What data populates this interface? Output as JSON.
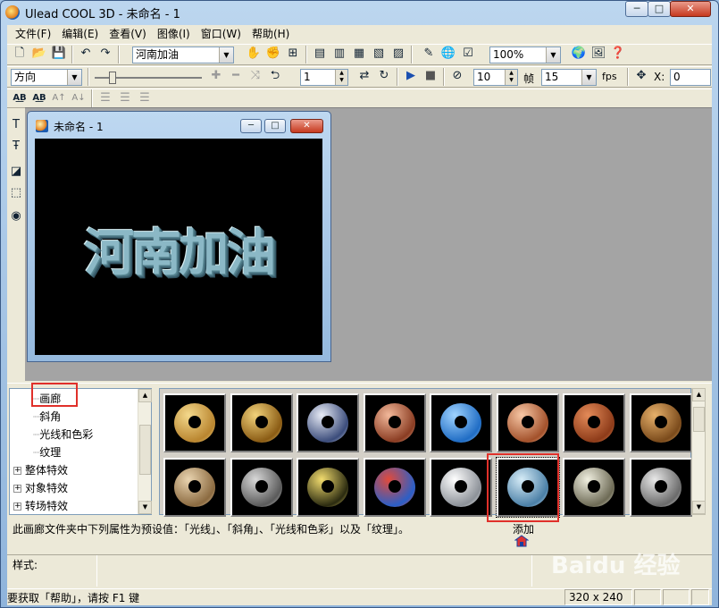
{
  "window": {
    "title": "Ulead COOL 3D - 未命名 - 1",
    "min_glyph": "─",
    "max_glyph": "□",
    "close_glyph": "✕"
  },
  "menu": [
    "文件(F)",
    "编辑(E)",
    "查看(V)",
    "图像(I)",
    "窗口(W)",
    "帮助(H)"
  ],
  "toolbar1": {
    "text_combo_value": "河南加油",
    "zoom_value": "100%"
  },
  "toolbar2": {
    "direction_value": "方向",
    "frame_value": "1",
    "frames_total_value": "10",
    "frame_label": "帧",
    "fps_value": "15",
    "fps_label": "fps",
    "x_label": "X:",
    "x_value": "0"
  },
  "document": {
    "title": "未命名 - 1",
    "canvas_text": "河南加油"
  },
  "tree": {
    "items": [
      {
        "label": "画廊",
        "type": "leaf",
        "selected": true
      },
      {
        "label": "斜角",
        "type": "leaf"
      },
      {
        "label": "光线和色彩",
        "type": "leaf"
      },
      {
        "label": "纹理",
        "type": "leaf"
      },
      {
        "label": "整体特效",
        "type": "group"
      },
      {
        "label": "对象特效",
        "type": "group"
      },
      {
        "label": "转场特效",
        "type": "group"
      }
    ]
  },
  "gallery": {
    "selected_index": 13,
    "thumbs": [
      {
        "name": "gold-ring",
        "colors": [
          "#f4d98c",
          "#b9852f"
        ]
      },
      {
        "name": "gold-shiny-ring",
        "colors": [
          "#f1d27a",
          "#8a5b14"
        ]
      },
      {
        "name": "chrome-dark-ring",
        "colors": [
          "#e8ecf6",
          "#3a4b7a"
        ]
      },
      {
        "name": "copper-ring",
        "colors": [
          "#f2b89a",
          "#8a3c22"
        ]
      },
      {
        "name": "blue-marble-ring",
        "colors": [
          "#9fd3ff",
          "#1f6cc4"
        ]
      },
      {
        "name": "rose-metal-ring",
        "colors": [
          "#f7c7a5",
          "#a2502a"
        ]
      },
      {
        "name": "brick-ring",
        "colors": [
          "#e38a58",
          "#8d3b19"
        ]
      },
      {
        "name": "bronze-tile-ring",
        "colors": [
          "#e6b06a",
          "#7a4a1b"
        ]
      },
      {
        "name": "stone-ring",
        "colors": [
          "#e9d4b0",
          "#8b6a40"
        ]
      },
      {
        "name": "perforated-steel-ring",
        "colors": [
          "#d8d8d8",
          "#5a5a5a"
        ]
      },
      {
        "name": "leopard-ring",
        "colors": [
          "#f2dc6e",
          "#2a2a10"
        ]
      },
      {
        "name": "stained-glass-ring",
        "colors": [
          "#e24a3a",
          "#2a5fc8"
        ]
      },
      {
        "name": "white-plastic-ring",
        "colors": [
          "#ffffff",
          "#8c9198"
        ]
      },
      {
        "name": "sky-glass-ring",
        "colors": [
          "#d6ecf7",
          "#4a7fa6"
        ]
      },
      {
        "name": "silver-gold-ring",
        "colors": [
          "#f0efe0",
          "#6d6a55"
        ]
      },
      {
        "name": "riveted-steel-ring",
        "colors": [
          "#e8e8e8",
          "#6a6a6a"
        ]
      }
    ]
  },
  "description": "此画廊文件夹中下列属性为预设值：「光线」、「斜角」、「光线和色彩」以及「纹理」。",
  "add_label": "添加",
  "style_label": "样式:",
  "status": {
    "help_text": "要获取「帮助」，请按 F1 键",
    "size": "320 x 240"
  },
  "watermark": "Baidu 经验",
  "colors": {
    "highlight_red": "#e0302a",
    "titlebar_blue": "#a9c8ea"
  }
}
